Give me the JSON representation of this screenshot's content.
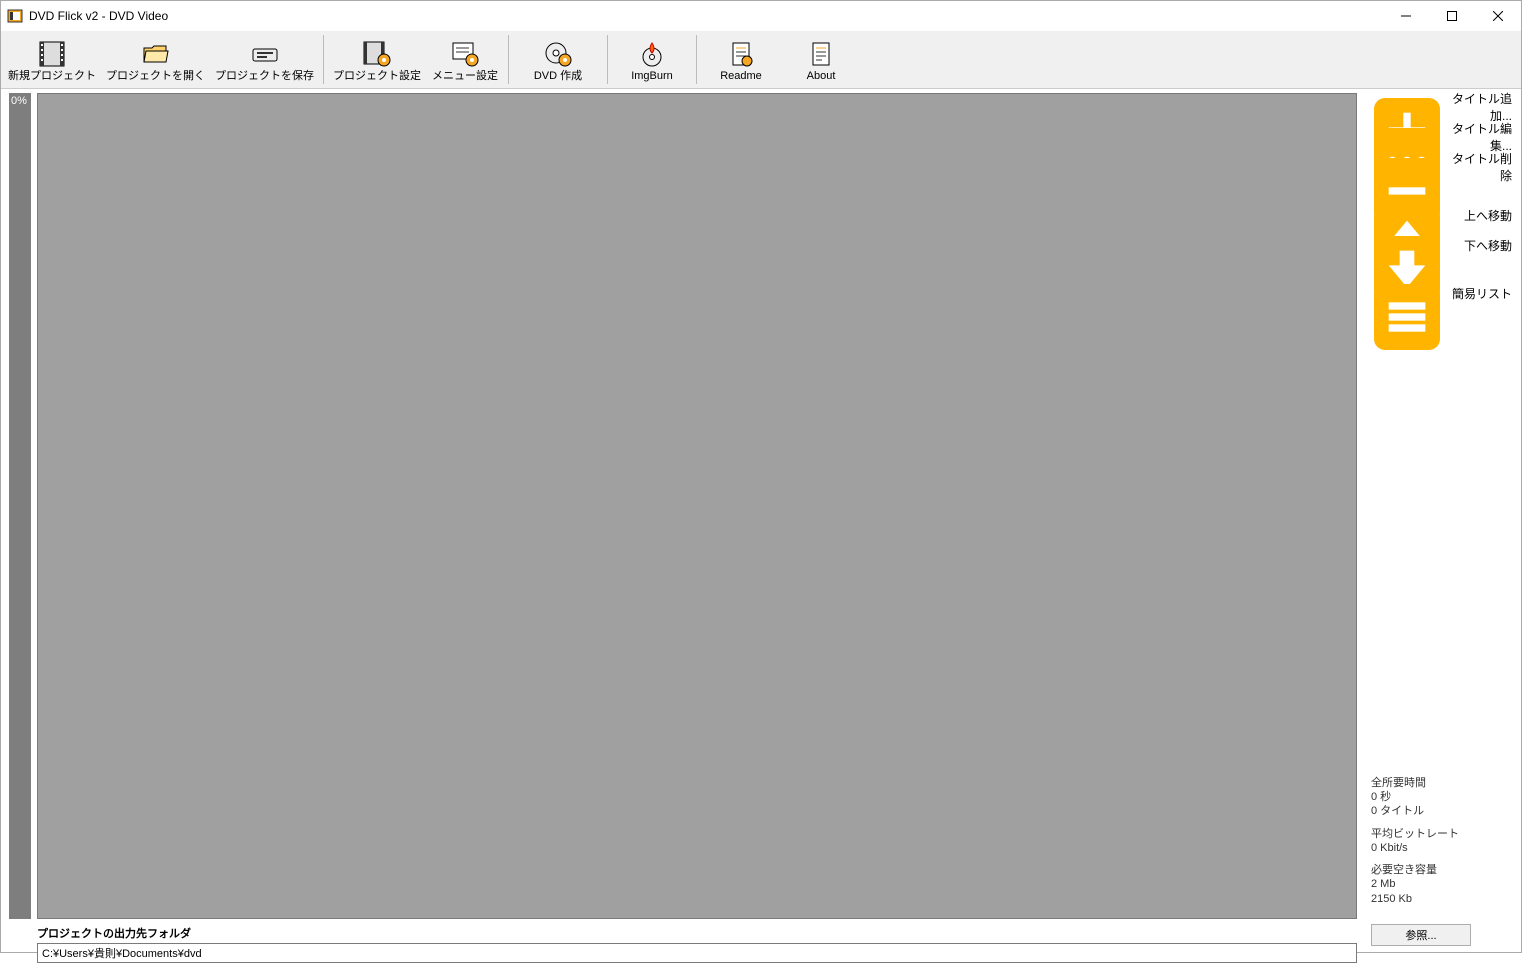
{
  "window": {
    "title": "DVD Flick v2 - DVD Video"
  },
  "toolbar": {
    "new_project": "新規プロジェクト",
    "open_project": "プロジェクトを開く",
    "save_project": "プロジェクトを保存",
    "project_settings": "プロジェクト設定",
    "menu_settings": "メニュー設定",
    "create_dvd": "DVD 作成",
    "imgburn": "ImgBurn",
    "readme": "Readme",
    "about": "About"
  },
  "gauge": {
    "percent": "0%"
  },
  "side": {
    "add_title": "タイトル追加...",
    "edit_title": "タイトル編集...",
    "delete_title": "タイトル削除",
    "move_up": "上へ移動",
    "move_down": "下へ移動",
    "easy_list": "簡易リスト"
  },
  "stats": {
    "total_time_label": "全所要時間",
    "total_time_value": "0 秒",
    "title_count": "0 タイトル",
    "bitrate_label": "平均ビットレート",
    "bitrate_value": "0 Kbit/s",
    "space_label": "必要空き容量",
    "space_value1": "2 Mb",
    "space_value2": "2150 Kb"
  },
  "output": {
    "label": "プロジェクトの出力先フォルダ",
    "path": "C:¥Users¥貴則¥Documents¥dvd",
    "browse": "参照..."
  }
}
